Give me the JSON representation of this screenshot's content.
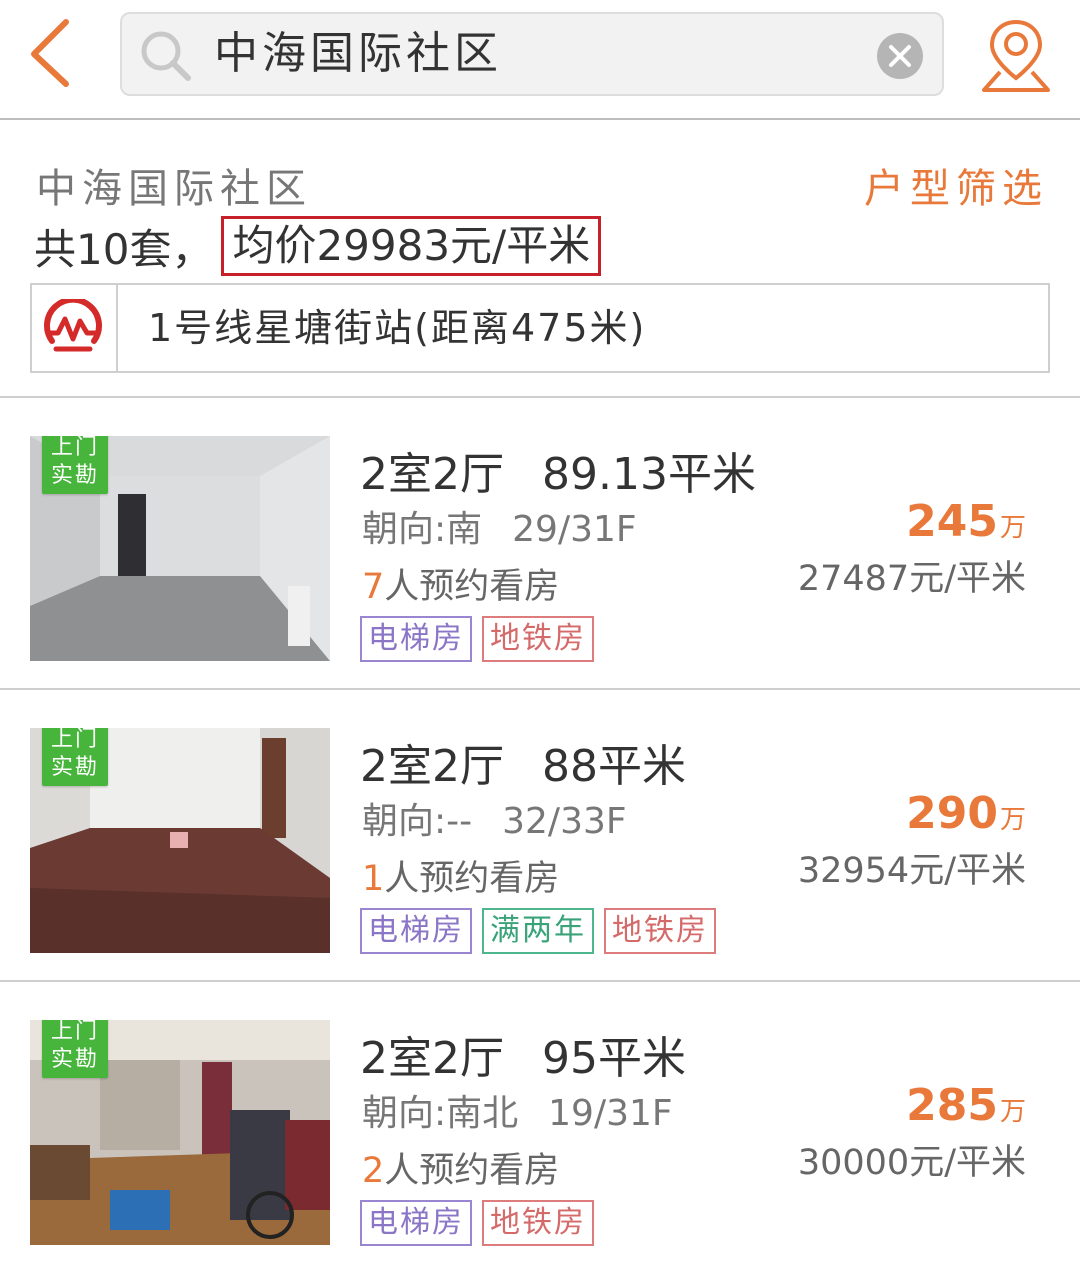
{
  "search": {
    "query": "中海国际社区"
  },
  "community": {
    "name": "中海国际社区",
    "filter_label": "户型筛选",
    "count_text": "共10套，",
    "avg_price_text": "均价29983元/平米",
    "metro_text": "1号线星塘街站(距离475米)"
  },
  "badge": {
    "line1": "上门",
    "line2": "实勘"
  },
  "listings": [
    {
      "layout": "2室2厅",
      "area": "89.13平米",
      "orientation": "朝向:南",
      "floor": "29/31F",
      "viewers_count": "7",
      "viewers_suffix": "人预约看房",
      "price": "245",
      "price_unit": "万",
      "unit_price": "27487元/平米",
      "tags": [
        {
          "label": "电梯房",
          "color": "purple"
        },
        {
          "label": "地铁房",
          "color": "red"
        }
      ]
    },
    {
      "layout": "2室2厅",
      "area": "88平米",
      "orientation": "朝向:--",
      "floor": "32/33F",
      "viewers_count": "1",
      "viewers_suffix": "人预约看房",
      "price": "290",
      "price_unit": "万",
      "unit_price": "32954元/平米",
      "tags": [
        {
          "label": "电梯房",
          "color": "purple"
        },
        {
          "label": "满两年",
          "color": "green"
        },
        {
          "label": "地铁房",
          "color": "red"
        }
      ]
    },
    {
      "layout": "2室2厅",
      "area": "95平米",
      "orientation": "朝向:南北",
      "floor": "19/31F",
      "viewers_count": "2",
      "viewers_suffix": "人预约看房",
      "price": "285",
      "price_unit": "万",
      "unit_price": "30000元/平米",
      "tags": [
        {
          "label": "电梯房",
          "color": "purple"
        },
        {
          "label": "地铁房",
          "color": "red"
        }
      ]
    }
  ],
  "colors": {
    "accent": "#e8793a",
    "highlight_border": "#c8202a",
    "badge_green": "#47b43c",
    "metro_red": "#d42a2a"
  },
  "icons": {
    "back": "chevron-left-icon",
    "search": "search-icon",
    "clear": "clear-icon",
    "location": "location-pin-icon",
    "metro": "metro-logo-icon"
  }
}
